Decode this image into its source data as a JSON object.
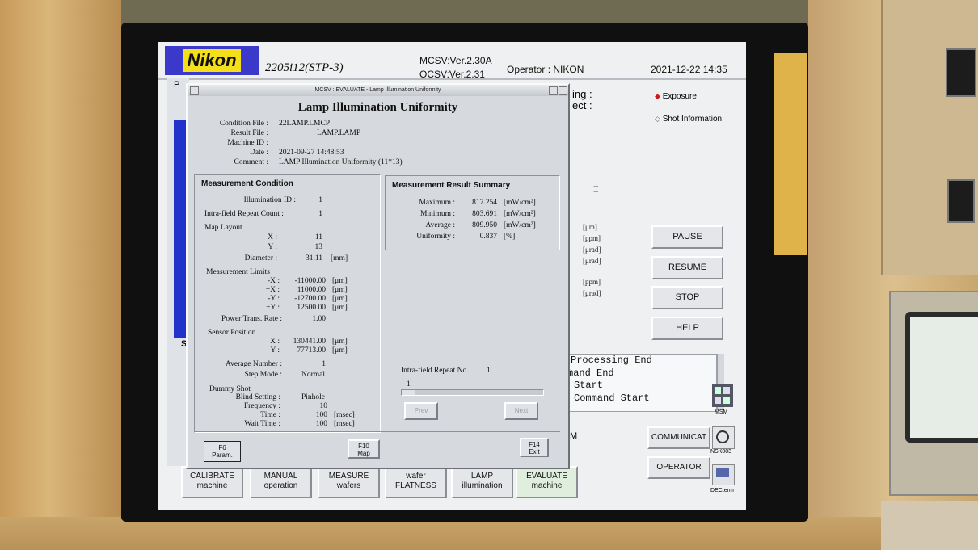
{
  "header": {
    "brand": "Nikon",
    "model": "2205i12(STP-3)",
    "mcsv": "MCSV:Ver.2.30A",
    "ocsv": "OCSV:Ver.2.31",
    "operator": "Operator : NIKON",
    "datetime": "2021-12-22 14:35"
  },
  "background": {
    "partial_labels": [
      "ing :",
      "ect :"
    ],
    "radio_exposure": "Exposure",
    "radio_shot_info": "Shot Information",
    "units": [
      "[μm]",
      "[ppm]",
      "[μrad]",
      "[μrad]",
      "[ppm]",
      "[μrad]"
    ],
    "buttons": {
      "pause": "PAUSE",
      "resume": "RESUME",
      "stop": "STOP",
      "help": "HELP"
    },
    "log_lines": [
      "Processing End",
      "mand End",
      " Start",
      " Command Start"
    ],
    "msm_label": "MSM",
    "nsk_label": "NSK003",
    "dec_label": "DECterm",
    "partial_m": "M",
    "communicat": "COMMUNICAT",
    "operator_btn": "OPERATOR",
    "left_stub_p": "P",
    "left_stub_se": "Se",
    "taskbar": [
      {
        "line1": "CALIBRATE",
        "line2": "machine"
      },
      {
        "line1": "MANUAL",
        "line2": "operation"
      },
      {
        "line1": "MEASURE",
        "line2": "wafers"
      },
      {
        "line1": "wafer",
        "line2": "FLATNESS"
      },
      {
        "line1": "LAMP",
        "line2": "illumination"
      },
      {
        "line1": "EVALUATE",
        "line2": "machine"
      }
    ]
  },
  "dialog": {
    "titlebar": "MCSV : EVALUATE - Lamp Illumination Uniformity",
    "title": "Lamp Illumination Uniformity",
    "info": {
      "condition_file_label": "Condition File :",
      "condition_file": "22LAMP.LMCP",
      "result_file_label": "Result File :",
      "result_file": "LAMP.LAMP",
      "machine_id_label": "Machine ID :",
      "date_label": "Date :",
      "date": "2021-09-27 14:48:53",
      "comment_label": "Comment :",
      "comment": "LAMP Illumination Uniformity (11*13)"
    },
    "condition": {
      "title": "Measurement Condition",
      "illumination_id_label": "Illumination ID :",
      "illumination_id": "1",
      "repeat_count_label": "Intra-field Repeat Count :",
      "repeat_count": "1",
      "map_layout_label": "Map Layout",
      "x_label": "X :",
      "x": "11",
      "y_label": "Y :",
      "y": "13",
      "diameter_label": "Diameter :",
      "diameter": "31.11",
      "diameter_unit": "[mm]",
      "limits_label": "Measurement Limits",
      "limits": [
        {
          "label": "-X :",
          "value": "-11000.00",
          "unit": "[μm]"
        },
        {
          "label": "+X :",
          "value": "11000.00",
          "unit": "[μm]"
        },
        {
          "label": "-Y :",
          "value": "-12700.00",
          "unit": "[μm]"
        },
        {
          "label": "+Y :",
          "value": "12500.00",
          "unit": "[μm]"
        }
      ],
      "power_rate_label": "Power Trans. Rate :",
      "power_rate": "1.00",
      "sensor_label": "Sensor Position",
      "sensor_x_label": "X :",
      "sensor_x": "130441.00",
      "sensor_y_label": "Y :",
      "sensor_y": "77713.00",
      "sensor_unit": "[μm]",
      "avg_label": "Average Number :",
      "avg": "1",
      "step_label": "Step Mode :",
      "step": "Normal",
      "dummy_label": "Dummy Shot",
      "blind_label": "Blind Setting :",
      "blind": "Pinhole",
      "freq_label": "Frequency :",
      "freq": "10",
      "time_label": "Time :",
      "time": "100",
      "time_unit": "[msec]",
      "wait_label": "Wait Time :",
      "wait": "100",
      "wait_unit": "[msec]"
    },
    "result": {
      "title": "Measurement Result Summary",
      "rows": [
        {
          "label": "Maximum :",
          "value": "817.254",
          "unit": "[mW/cm²]"
        },
        {
          "label": "Minimum :",
          "value": "803.691",
          "unit": "[mW/cm²]"
        },
        {
          "label": "Average :",
          "value": "809.950",
          "unit": "[mW/cm²]"
        },
        {
          "label": "Uniformity :",
          "value": "0.837",
          "unit": "[%]"
        }
      ]
    },
    "repeat_no_label": "Intra-field Repeat No.",
    "repeat_no": "1",
    "slider_value": "1",
    "prev": "Prev",
    "next": "Next",
    "f6": {
      "key": "F6",
      "label": "Param."
    },
    "f10": {
      "key": "F10",
      "label": "Map"
    },
    "f14": {
      "key": "F14",
      "label": "Exit"
    }
  }
}
